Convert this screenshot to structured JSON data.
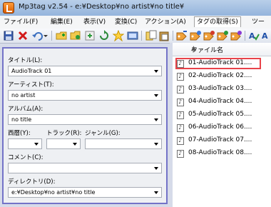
{
  "window": {
    "title": "Mp3tag v2.54  -  e:¥Desktop¥no artist¥no title¥"
  },
  "menu": [
    {
      "label": "ファイル(F)"
    },
    {
      "label": "編集(E)"
    },
    {
      "label": "表示(V)"
    },
    {
      "label": "変換(C)"
    },
    {
      "label": "アクション(A)"
    },
    {
      "label": "タグの取得(S)"
    },
    {
      "label": "ツー"
    }
  ],
  "toolbar": {
    "icons": [
      "save-icon",
      "delete-icon",
      "undo-icon",
      "dropdown-icon",
      "add-folder-icon",
      "open-folder-icon",
      "refresh-icon",
      "favorite-star-icon",
      "settings-icon",
      "copy-tag-icon",
      "paste-tag-icon",
      "tag-to-filename-icon",
      "filename-to-tag-icon",
      "text-to-tag-icon",
      "tag-to-tag-icon",
      "tag-sources-icon",
      "spellcheck-icon",
      "font-icon"
    ]
  },
  "tag_panel": {
    "title": {
      "label": "タイトル(L):",
      "value": "AudioTrack 01"
    },
    "artist": {
      "label": "アーティスト(T):",
      "value": "no artist"
    },
    "album": {
      "label": "アルバム(A):",
      "value": "no title"
    },
    "year": {
      "label": "西暦(Y):",
      "value": ""
    },
    "track": {
      "label": "トラック(R):",
      "value": ""
    },
    "genre": {
      "label": "ジャンル(G):",
      "value": ""
    },
    "comment": {
      "label": "コメント(C):",
      "value": ""
    },
    "directory": {
      "label": "ディレクトリ(D):",
      "value": "e:¥Desktop¥no artist¥no title"
    }
  },
  "file_list": {
    "column_header": "ファイル名",
    "files": [
      "01-AudioTrack 01....",
      "02-AudioTrack 02....",
      "03-AudioTrack 03....",
      "04-AudioTrack 04....",
      "05-AudioTrack 05....",
      "06-AudioTrack 06....",
      "07-AudioTrack 07....",
      "08-AudioTrack 08...."
    ],
    "selected_index": 0
  },
  "colors": {
    "panel_border": "#7373c8",
    "selection_highlight": "#e8434a"
  }
}
